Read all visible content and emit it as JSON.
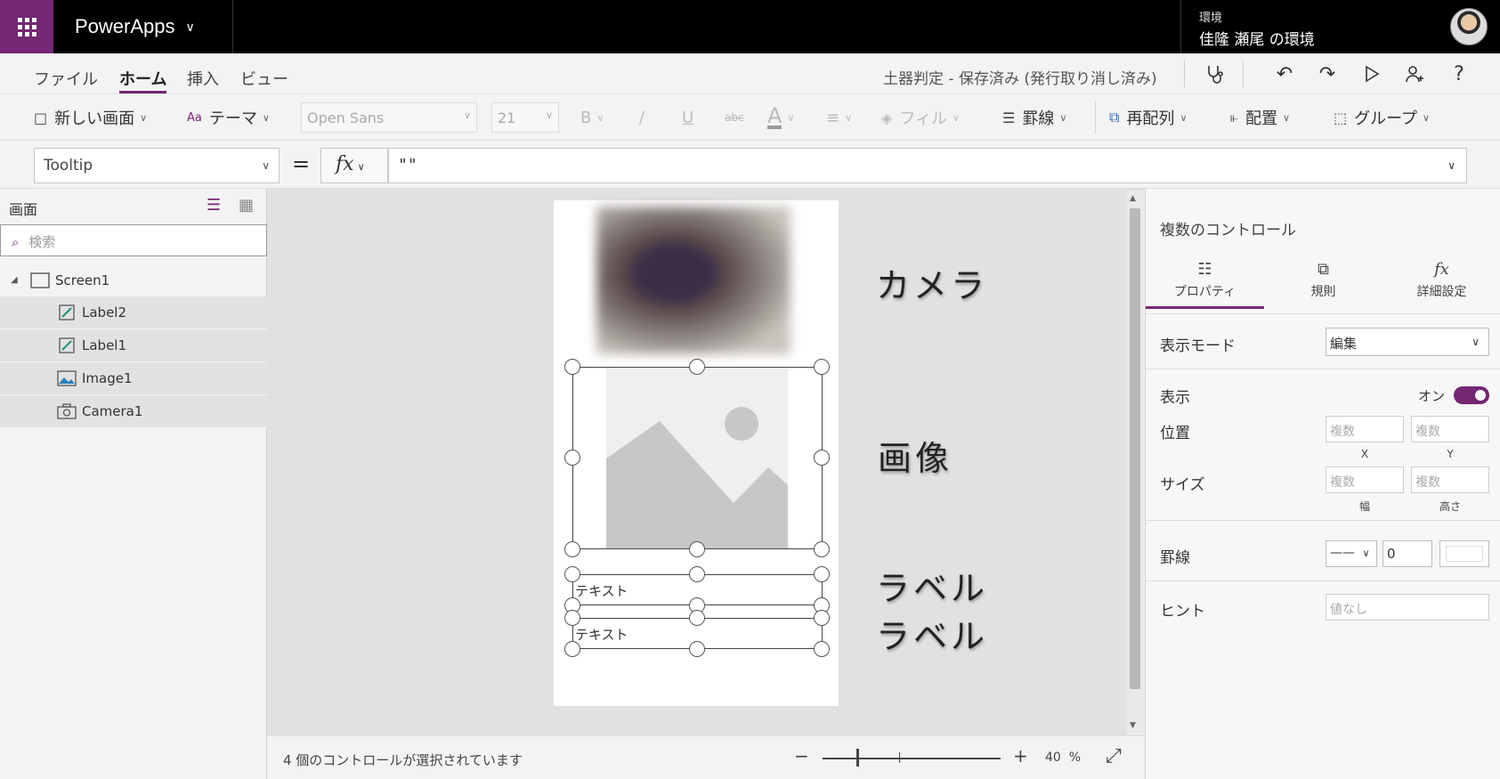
{
  "topbar": {
    "app_name": "PowerApps",
    "env_label": "環境",
    "env_name": "佳隆 瀬尾 の環境"
  },
  "menu": {
    "tabs": [
      "ファイル",
      "ホーム",
      "挿入",
      "ビュー"
    ],
    "active_tab": "ホーム",
    "doc_status": "土器判定 - 保存済み (発行取り消し済み)",
    "icons": [
      "app-checker-icon",
      "undo-icon",
      "redo-icon",
      "preview-play-icon",
      "share-user-icon",
      "help-icon"
    ],
    "help_label": "?"
  },
  "ribbon": {
    "new_screen": "新しい画面",
    "theme": "テーマ",
    "font_name": "Open Sans",
    "font_size": "21",
    "bold": "B",
    "italic": "/",
    "underline": "U",
    "strike": "abc",
    "font_color": "A",
    "fill": "フィル",
    "border": "罫線",
    "reorder": "再配列",
    "align": "配置",
    "group": "グループ"
  },
  "formula": {
    "property": "Tooltip",
    "equals": "=",
    "fx": "fx",
    "value": "\"\""
  },
  "tree": {
    "title": "画面",
    "search_placeholder": "検索",
    "screen": "Screen1",
    "items": [
      {
        "label": "Label2",
        "icon": "label-edit-icon"
      },
      {
        "label": "Label1",
        "icon": "label-edit-icon"
      },
      {
        "label": "Image1",
        "icon": "image-icon"
      },
      {
        "label": "Camera1",
        "icon": "camera-icon"
      }
    ]
  },
  "canvas": {
    "label_text_1": "テキスト",
    "label_text_2": "テキスト",
    "annotations": {
      "camera": "カメラ",
      "image": "画像",
      "label1": "ラベル",
      "label2": "ラベル"
    }
  },
  "status": {
    "selection_text": "4 個のコントロールが選択されています",
    "zoom_minus": "−",
    "zoom_plus": "+",
    "zoom_value": "40",
    "zoom_unit": "%",
    "zoom_level": 0.4
  },
  "props": {
    "title": "複数のコントロール",
    "tabs": [
      "プロパティ",
      "規則",
      "詳細設定"
    ],
    "active_tab": "プロパティ",
    "display_mode_label": "表示モード",
    "display_mode_value": "編集",
    "visible_label": "表示",
    "visible_value": "オン",
    "position_label": "位置",
    "size_label": "サイズ",
    "multi_placeholder": "複数",
    "x_label": "X",
    "y_label": "Y",
    "width_label": "幅",
    "height_label": "高さ",
    "border_label": "罫線",
    "border_width": "0",
    "hint_label": "ヒント",
    "hint_placeholder": "値なし"
  },
  "colors": {
    "brand": "#742774",
    "topbar": "#000000",
    "canvas_bg": "#e1e1e1"
  }
}
